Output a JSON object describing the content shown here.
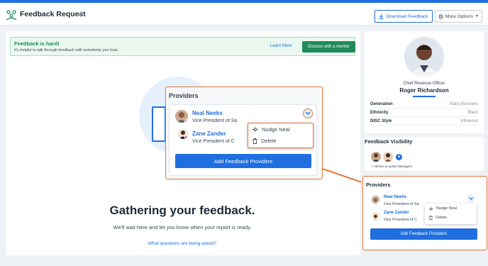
{
  "header": {
    "title": "Feedback Request",
    "download_label": "Download Feedback",
    "more_label": "More Options"
  },
  "banner": {
    "title": "Feedback is hard!",
    "text": "It's helpful to talk through feedback with somebody you trust.",
    "learn_more": "Learn More",
    "mentor_button": "Discuss with a mentor"
  },
  "status": {
    "heading": "Gathering your feedback.",
    "subtext": "We'll wait here and let you know when your report is ready.",
    "questions_link": "What questions are being asked?"
  },
  "providers_zoom": {
    "title": "Providers",
    "providers": [
      {
        "name": "Neal Neeks",
        "role": "Vice President of Sa"
      },
      {
        "name": "Zane Zander",
        "role": "Vice President of C"
      }
    ],
    "menu": [
      {
        "label": "Nudge Neal",
        "icon": "nudge-icon"
      },
      {
        "label": "Delete",
        "icon": "trash-icon"
      }
    ],
    "add_button": "Add Feedback Providers"
  },
  "profile": {
    "job_title": "Chief Revenue Officer",
    "name": "Roger Richardson",
    "attributes": [
      {
        "label": "Generation",
        "value": "Baby Boomers"
      },
      {
        "label": "Ethnicity",
        "value": "Black"
      },
      {
        "label": "DISC Style",
        "value": "Influence"
      }
    ]
  },
  "visibility": {
    "title": "Feedback Visibility",
    "caption": "+ Admins & Upline Managers"
  },
  "providers_sidebar": {
    "title": "Providers",
    "providers": [
      {
        "name": "Neal Neeks",
        "role": "Vice President of Sa"
      },
      {
        "name": "Zane Zander",
        "role": "Vice President of C"
      }
    ],
    "menu": [
      {
        "label": "Nudge Neal",
        "icon": "nudge-icon"
      },
      {
        "label": "Delete",
        "icon": "trash-icon"
      }
    ],
    "add_button": "Add Feedback Providers"
  },
  "colors": {
    "accent": "#1f6fe0",
    "highlight": "#e0763a",
    "success": "#1f8a5a"
  }
}
